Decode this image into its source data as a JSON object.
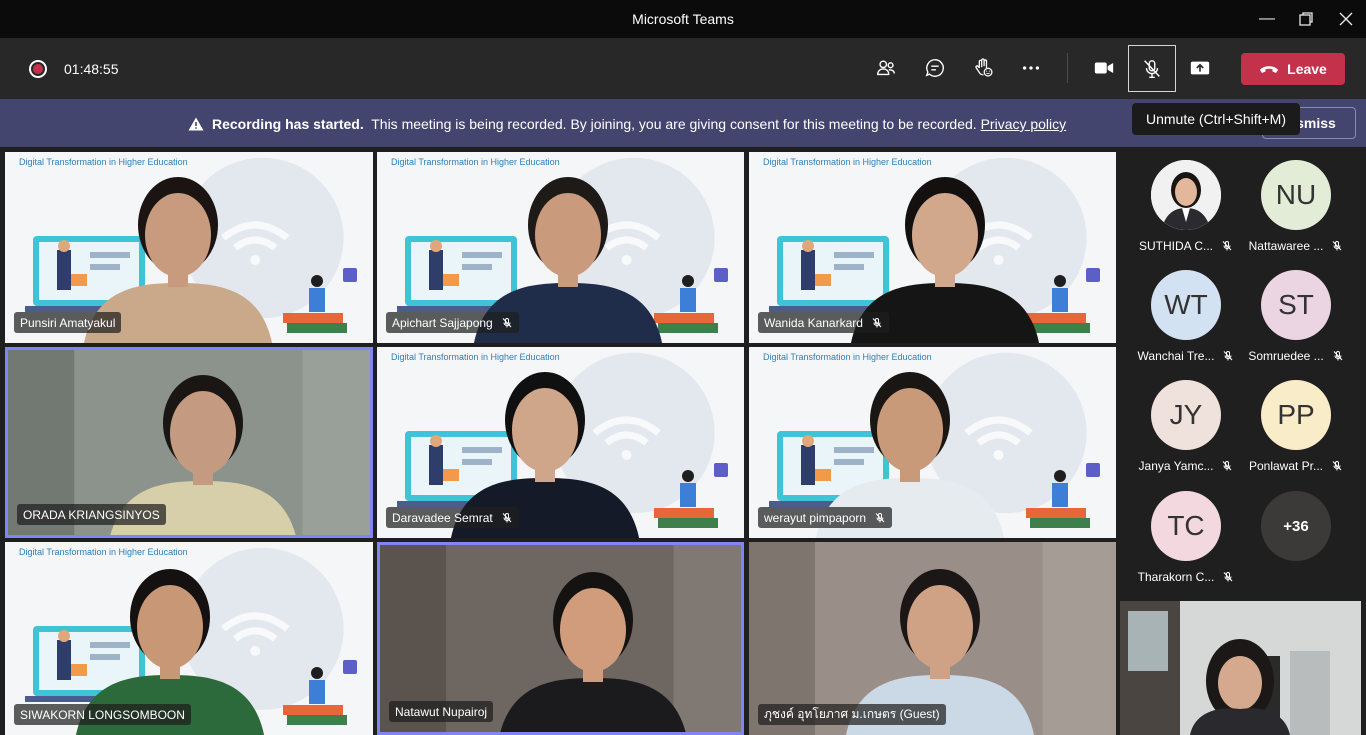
{
  "window": {
    "title": "Microsoft Teams"
  },
  "toolbar": {
    "timer": "01:48:55",
    "leave_label": "Leave"
  },
  "banner": {
    "bold": "Recording has started.",
    "text": "This meeting is being recorded. By joining, you are giving consent for this meeting to be recorded.",
    "link": "Privacy policy",
    "dismiss": "Dismiss"
  },
  "tooltip": "Unmute (Ctrl+Shift+M)",
  "slide_heading": "Digital Transformation in Higher Education",
  "tiles": [
    {
      "name": "Punsiri Amatyakul"
    },
    {
      "name": "Apichart Sajjapong"
    },
    {
      "name": "Wanida Kanarkard"
    },
    {
      "name": "ORADA KRIANGSINYOS"
    },
    {
      "name": "Daravadee Semrat"
    },
    {
      "name": "werayut pimpaporn"
    },
    {
      "name": "SIWAKORN LONGSOMBOON"
    },
    {
      "name": "Natawut Nupairoj"
    },
    {
      "name": "ภุชงค์ อุทโยภาศ ม.เกษตร (Guest)"
    }
  ],
  "roster": [
    {
      "name": "SUTHIDA C...",
      "initials": "",
      "color": "#ffffff"
    },
    {
      "name": "Nattawaree ...",
      "initials": "NU",
      "color": "#e3ecd6"
    },
    {
      "name": "Wanchai Tre...",
      "initials": "WT",
      "color": "#d3e2f3"
    },
    {
      "name": "Somruedee ...",
      "initials": "ST",
      "color": "#ecd5e3"
    },
    {
      "name": "Janya Yamc...",
      "initials": "JY",
      "color": "#efe2dd"
    },
    {
      "name": "Ponlawat Pr...",
      "initials": "PP",
      "color": "#f9ecc9"
    },
    {
      "name": "Tharakorn C...",
      "initials": "TC",
      "color": "#f3d8df"
    },
    {
      "name": "",
      "initials": "+36",
      "color": "#3b3a39"
    }
  ]
}
